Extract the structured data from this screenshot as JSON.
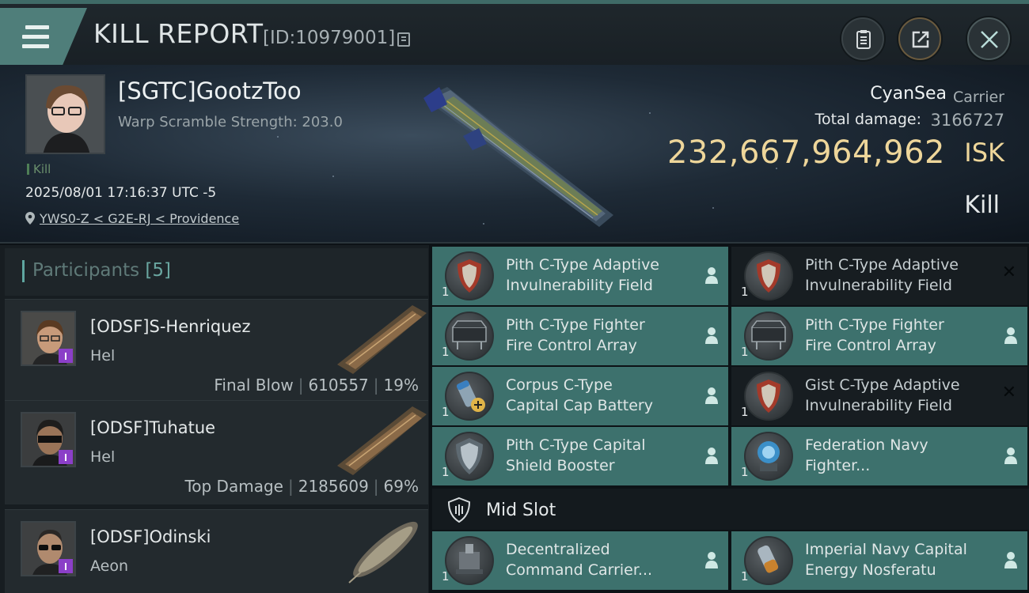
{
  "header": {
    "title": "KILL REPORT",
    "id_text": "[ID:10979001]"
  },
  "victim": {
    "name": "[SGTC]GootzToo",
    "warp_scramble": "Warp Scramble Strength: 203.0",
    "kill_tag": "Kill",
    "datetime": "2025/08/01 17:16:37 UTC -5",
    "location": "YWS0-Z < G2E-RJ < Providence",
    "corp": "CyanSea",
    "ship_class": "Carrier",
    "total_damage_label": "Total damage:",
    "total_damage": "3166727",
    "isk_value": "232,667,964,962",
    "isk_unit": "ISK",
    "kill_label": "Kill"
  },
  "participants": {
    "label": "Participants",
    "count": "[5]",
    "list": [
      {
        "name": "[ODSF]S-Henriquez",
        "ship": "Hel",
        "role": "Final Blow",
        "damage": "610557",
        "percent": "19%"
      },
      {
        "name": "[ODSF]Tuhatue",
        "ship": "Hel",
        "role": "Top Damage",
        "damage": "2185609",
        "percent": "69%"
      },
      {
        "name": "[ODSF]Odinski",
        "ship": "Aeon",
        "role": "",
        "damage": "",
        "percent": ""
      }
    ]
  },
  "items": [
    {
      "name_line1": "Pith C-Type Adaptive",
      "name_line2": "Invulnerability Field",
      "qty": "1",
      "status": "dropped"
    },
    {
      "name_line1": "Pith C-Type Adaptive",
      "name_line2": "Invulnerability Field",
      "qty": "1",
      "status": "destroyed"
    },
    {
      "name_line1": "Pith C-Type Fighter",
      "name_line2": "Fire Control Array",
      "qty": "1",
      "status": "dropped"
    },
    {
      "name_line1": "Pith C-Type Fighter",
      "name_line2": "Fire Control Array",
      "qty": "1",
      "status": "dropped"
    },
    {
      "name_line1": "Corpus C-Type",
      "name_line2": "Capital Cap Battery",
      "qty": "1",
      "status": "dropped"
    },
    {
      "name_line1": "Gist C-Type Adaptive",
      "name_line2": "Invulnerability Field",
      "qty": "1",
      "status": "destroyed"
    },
    {
      "name_line1": "Pith C-Type Capital",
      "name_line2": "Shield Booster",
      "qty": "1",
      "status": "dropped"
    },
    {
      "name_line1": "Federation Navy",
      "name_line2": "Fighter...",
      "qty": "1",
      "status": "dropped"
    }
  ],
  "mid_slot": {
    "label": "Mid Slot",
    "items": [
      {
        "name_line1": "Decentralized",
        "name_line2": "Command Carrier...",
        "qty": "1",
        "status": "dropped"
      },
      {
        "name_line1": "Imperial Navy Capital",
        "name_line2": "Energy Nosferatu",
        "qty": "1",
        "status": "dropped"
      }
    ]
  },
  "colors": {
    "accent": "#3d716d",
    "isk": "#eed69a",
    "badge": "#8b3fc8"
  }
}
